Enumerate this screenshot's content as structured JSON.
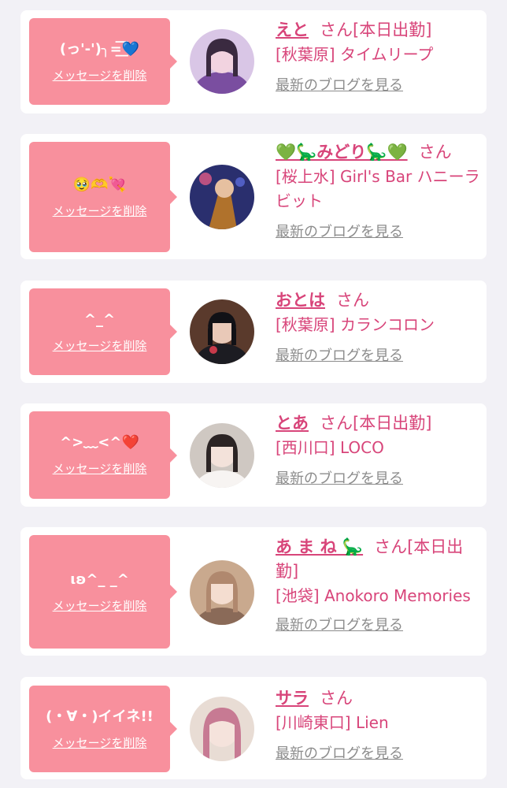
{
  "cards": [
    {
      "message": "(っ'-')╮=͟͟͞͞💙",
      "delete_label": "メッセージを削除",
      "name": "えと",
      "honorific": "さん",
      "status": "[本日出勤]",
      "shop": "[秋葉原] タイムリープ",
      "blog_label": "最新のブログを見る",
      "avatar_colors": [
        "#d9c6e6",
        "#7a4ea0",
        "#f2d3e0"
      ]
    },
    {
      "message": "🥹🫶💘",
      "delete_label": "メッセージを削除",
      "name": "💚🦕みどり🦕💚",
      "honorific": "さん",
      "status": "",
      "shop": "[桜上水] Girl's Bar ハニーラビット",
      "blog_label": "最新のブログを見る",
      "avatar_colors": [
        "#2a2f6e",
        "#b0722c",
        "#e05a86"
      ]
    },
    {
      "message": "^_^",
      "delete_label": "メッセージを削除",
      "name": "おとは",
      "honorific": "さん",
      "status": "",
      "shop": "[秋葉原] カランコロン",
      "blog_label": "最新のブログを見る",
      "avatar_colors": [
        "#5a3a2c",
        "#1c1c22",
        "#e9c9b8"
      ]
    },
    {
      "message": "^>﹏<^❤️",
      "delete_label": "メッセージを削除",
      "name": "とあ",
      "honorific": "さん",
      "status": "[本日出勤]",
      "shop": "[西川口] LOCO",
      "blog_label": "最新のブログを見る",
      "avatar_colors": [
        "#cfc8c2",
        "#2b2424",
        "#f3e2da"
      ]
    },
    {
      "message": "ιʚ^_ _^",
      "delete_label": "メッセージを削除",
      "name": "あ ま ね 🦕",
      "honorific": "さん",
      "status": "[本日出勤]",
      "shop": "[池袋] Anokoro Memories",
      "blog_label": "最新のブログを見る",
      "avatar_colors": [
        "#c9a98e",
        "#8a6a58",
        "#f4ddd0"
      ]
    },
    {
      "message": "(・∀・)イイネ!!",
      "delete_label": "メッセージを削除",
      "name": "サラ",
      "honorific": "さん",
      "status": "",
      "shop": "[川崎東口] Lien",
      "blog_label": "最新のブログを見る",
      "avatar_colors": [
        "#e8dcd4",
        "#c77a93",
        "#f5e3dc"
      ]
    }
  ]
}
